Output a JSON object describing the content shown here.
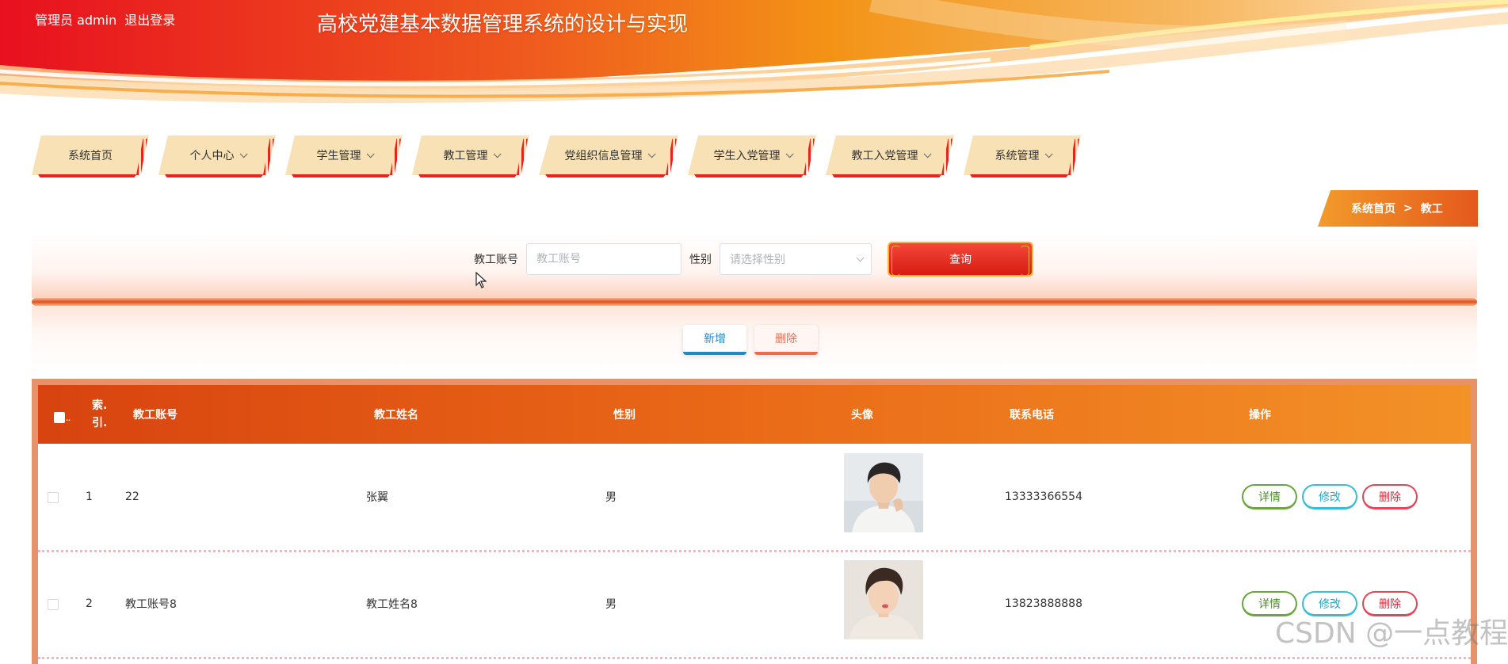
{
  "header": {
    "user_label": "管理员 admin",
    "logout_label": "退出登录",
    "system_title": "高校党建基本数据管理系统的设计与实现"
  },
  "nav": {
    "items": [
      {
        "label": "系统首页",
        "has_dropdown": false
      },
      {
        "label": "个人中心",
        "has_dropdown": true
      },
      {
        "label": "学生管理",
        "has_dropdown": true
      },
      {
        "label": "教工管理",
        "has_dropdown": true
      },
      {
        "label": "党组织信息管理",
        "has_dropdown": true
      },
      {
        "label": "学生入党管理",
        "has_dropdown": true
      },
      {
        "label": "教工入党管理",
        "has_dropdown": true
      },
      {
        "label": "系统管理",
        "has_dropdown": true
      }
    ]
  },
  "breadcrumb": {
    "home": "系统首页",
    "separator": ">",
    "current": "教工"
  },
  "search": {
    "account_label": "教工账号",
    "account_placeholder": "教工账号",
    "gender_label": "性别",
    "gender_placeholder": "请选择性别",
    "query_label": "查询"
  },
  "actions": {
    "add_label": "新增",
    "delete_label": "删除"
  },
  "table": {
    "headers": {
      "index_line1": "索.",
      "index_line2": "引.",
      "account": "教工账号",
      "name": "教工姓名",
      "gender": "性别",
      "avatar": "头像",
      "phone": "联系电话",
      "ops": "操作"
    },
    "rows": [
      {
        "index": "1",
        "account": "22",
        "name": "张翼",
        "gender": "男",
        "phone": "13333366554"
      },
      {
        "index": "2",
        "account": "教工账号8",
        "name": "教工姓名8",
        "gender": "男",
        "phone": "13823888888"
      }
    ],
    "row_ops": {
      "detail": "详情",
      "edit": "修改",
      "delete": "删除"
    }
  },
  "watermark": "CSDN @一点教程",
  "colors": {
    "banner_red": "#e8151f",
    "banner_orange": "#f39316",
    "nav_bg": "#f7e1b5",
    "accent_red": "#e8231b",
    "table_header": "#e0591a"
  }
}
